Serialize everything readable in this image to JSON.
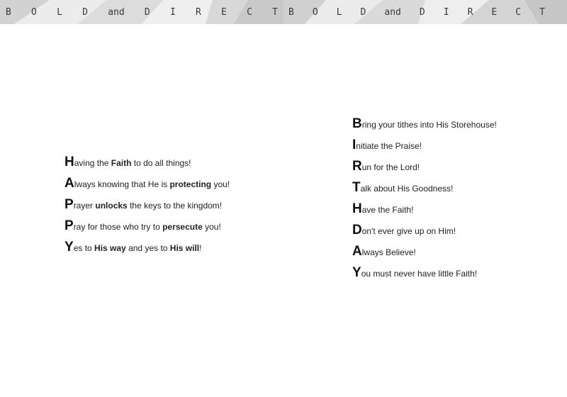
{
  "header": {
    "banner_left": [
      "B",
      "O",
      "L",
      "D",
      "and",
      "D",
      "I",
      "R",
      "E",
      "C",
      "T"
    ],
    "banner_right": [
      "B",
      "O",
      "L",
      "D",
      "and",
      "D",
      "I",
      "R",
      "E",
      "C",
      "T"
    ]
  },
  "happy": [
    {
      "cap": "H",
      "segments": [
        {
          "t": "aving the ",
          "b": false
        },
        {
          "t": "Faith",
          "b": true
        },
        {
          "t": " to do all things!",
          "b": false
        }
      ]
    },
    {
      "cap": "A",
      "segments": [
        {
          "t": "lways knowing that He is ",
          "b": false
        },
        {
          "t": "protecting",
          "b": true
        },
        {
          "t": " you!",
          "b": false
        }
      ]
    },
    {
      "cap": "P",
      "segments": [
        {
          "t": "rayer ",
          "b": false
        },
        {
          "t": "unlocks",
          "b": true
        },
        {
          "t": " the keys to the kingdom!",
          "b": false
        }
      ]
    },
    {
      "cap": "P",
      "segments": [
        {
          "t": "ray for those who try to ",
          "b": false
        },
        {
          "t": "persecute",
          "b": true
        },
        {
          "t": " you!",
          "b": false
        }
      ]
    },
    {
      "cap": "Y",
      "segments": [
        {
          "t": "es to ",
          "b": false
        },
        {
          "t": "His way",
          "b": true
        },
        {
          "t": " and yes to ",
          "b": false
        },
        {
          "t": "His will",
          "b": true
        },
        {
          "t": "!",
          "b": false
        }
      ]
    }
  ],
  "birthday": [
    {
      "cap": "B",
      "segments": [
        {
          "t": "ring your tithes into His Storehouse!",
          "b": false
        }
      ]
    },
    {
      "cap": "I",
      "segments": [
        {
          "t": "nitiate the Praise!",
          "b": false
        }
      ]
    },
    {
      "cap": "R",
      "segments": [
        {
          "t": "un for the Lord!",
          "b": false
        }
      ]
    },
    {
      "cap": "T",
      "segments": [
        {
          "t": "alk about His Goodness!",
          "b": false
        }
      ]
    },
    {
      "cap": "H",
      "segments": [
        {
          "t": "ave the Faith!",
          "b": false
        }
      ]
    },
    {
      "cap": "D",
      "segments": [
        {
          "t": "on't ever give up on Him!",
          "b": false
        }
      ]
    },
    {
      "cap": "A",
      "segments": [
        {
          "t": "lways Believe!",
          "b": false
        }
      ]
    },
    {
      "cap": "Y",
      "segments": [
        {
          "t": "ou must never have little Faith!",
          "b": false
        }
      ]
    }
  ]
}
